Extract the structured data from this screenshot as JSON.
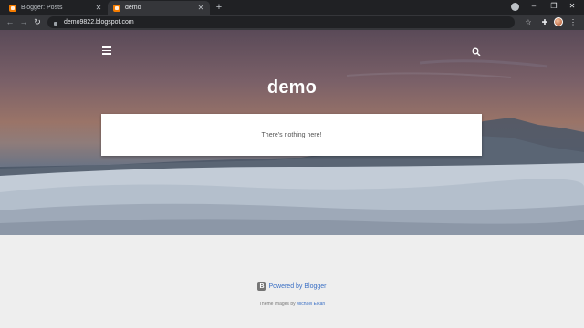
{
  "browser": {
    "tabs": [
      {
        "title": "Blogger: Posts",
        "active": false
      },
      {
        "title": "demo",
        "active": true
      }
    ],
    "new_tab_glyph": "+",
    "close_glyph": "✕",
    "url": "demo9822.blogspot.com",
    "window_controls": [
      "–",
      "❐",
      "✕"
    ],
    "colors": {
      "frame": "#202124",
      "toolbar": "#35363a"
    }
  },
  "blog": {
    "title": "demo",
    "empty_message": "There's nothing here!",
    "menu_icon": "hamburger-menu-icon",
    "search_icon": "search-icon"
  },
  "footer": {
    "powered_by": "Powered by Blogger",
    "theme_prefix": "Theme images by",
    "theme_author": "Michael Elkan"
  },
  "colors": {
    "accent": "#3a6fc4",
    "footer_bg": "#eeeeee",
    "card_bg": "#ffffff"
  }
}
